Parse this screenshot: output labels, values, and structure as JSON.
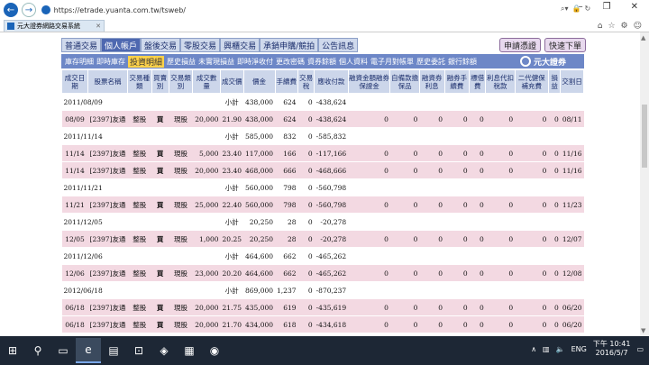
{
  "browser": {
    "url": "https://etrade.yuanta.com.tw/tsweb/",
    "tab_title": "元大證券網路交易系統",
    "window_controls": [
      "–",
      "❐",
      "✕"
    ]
  },
  "menu": {
    "items": [
      "普通交易",
      "個人帳戶",
      "盤後交易",
      "零股交易",
      "興櫃交易",
      "承銷申購/競拍",
      "公告訊息"
    ],
    "active_index": 1,
    "right_buttons": [
      "申請憑證",
      "快速下單"
    ]
  },
  "submenu": {
    "items": [
      "庫存明細",
      "即時庫存",
      "投資明細",
      "歷史損益",
      "未實現損益",
      "即時淨收付",
      "更改密碼",
      "資券餘額",
      "個人資料",
      "電子月對帳單",
      "歷史委託",
      "銀行餘額"
    ],
    "active_index": 2,
    "logo_text": "元大證券"
  },
  "table": {
    "headers": [
      "成交日期",
      "股票名稱",
      "交易種類",
      "買賣別",
      "交易類別",
      "成交數量",
      "成交價",
      "價金",
      "手續費",
      "交易稅",
      "應收付款",
      "融資金額融券保證金",
      "自備款擔保品",
      "融資券利息",
      "融券手續費",
      "標借費",
      "利息代扣稅款",
      "二代健保補充費",
      "損益",
      "交割日"
    ],
    "rows": [
      {
        "type": "sum",
        "date": "2011/08/09",
        "label": "小計",
        "amount": "438,000",
        "fee": "624",
        "tax": "0",
        "net": "-438,624"
      },
      {
        "type": "det",
        "date": "08/09",
        "stock": "[2397]友通",
        "kind": "整股",
        "side": "買",
        "cat": "現股",
        "qty": "20,000",
        "price": "21.90",
        "amount": "438,000",
        "fee": "624",
        "tax": "0",
        "net": "-438,624",
        "z1": "0",
        "z2": "0",
        "z3": "0",
        "z4": "0",
        "z5": "0",
        "z6": "0",
        "z7": "0",
        "z8": "0",
        "settle": "08/11"
      },
      {
        "type": "sum",
        "date": "2011/11/14",
        "label": "小計",
        "amount": "585,000",
        "fee": "832",
        "tax": "0",
        "net": "-585,832"
      },
      {
        "type": "det",
        "date": "11/14",
        "stock": "[2397]友通",
        "kind": "整股",
        "side": "買",
        "cat": "現股",
        "qty": "5,000",
        "price": "23.40",
        "amount": "117,000",
        "fee": "166",
        "tax": "0",
        "net": "-117,166",
        "z1": "0",
        "z2": "0",
        "z3": "0",
        "z4": "0",
        "z5": "0",
        "z6": "0",
        "z7": "0",
        "z8": "0",
        "settle": "11/16"
      },
      {
        "type": "det",
        "date": "11/14",
        "stock": "[2397]友通",
        "kind": "整股",
        "side": "買",
        "cat": "現股",
        "qty": "20,000",
        "price": "23.40",
        "amount": "468,000",
        "fee": "666",
        "tax": "0",
        "net": "-468,666",
        "z1": "0",
        "z2": "0",
        "z3": "0",
        "z4": "0",
        "z5": "0",
        "z6": "0",
        "z7": "0",
        "z8": "0",
        "settle": "11/16"
      },
      {
        "type": "sum",
        "date": "2011/11/21",
        "label": "小計",
        "amount": "560,000",
        "fee": "798",
        "tax": "0",
        "net": "-560,798"
      },
      {
        "type": "det",
        "date": "11/21",
        "stock": "[2397]友通",
        "kind": "整股",
        "side": "買",
        "cat": "現股",
        "qty": "25,000",
        "price": "22.40",
        "amount": "560,000",
        "fee": "798",
        "tax": "0",
        "net": "-560,798",
        "z1": "0",
        "z2": "0",
        "z3": "0",
        "z4": "0",
        "z5": "0",
        "z6": "0",
        "z7": "0",
        "z8": "0",
        "settle": "11/23"
      },
      {
        "type": "sum",
        "date": "2011/12/05",
        "label": "小計",
        "amount": "20,250",
        "fee": "28",
        "tax": "0",
        "net": "-20,278"
      },
      {
        "type": "det",
        "date": "12/05",
        "stock": "[2397]友通",
        "kind": "整股",
        "side": "買",
        "cat": "現股",
        "qty": "1,000",
        "price": "20.25",
        "amount": "20,250",
        "fee": "28",
        "tax": "0",
        "net": "-20,278",
        "z1": "0",
        "z2": "0",
        "z3": "0",
        "z4": "0",
        "z5": "0",
        "z6": "0",
        "z7": "0",
        "z8": "0",
        "settle": "12/07"
      },
      {
        "type": "sum",
        "date": "2011/12/06",
        "label": "小計",
        "amount": "464,600",
        "fee": "662",
        "tax": "0",
        "net": "-465,262"
      },
      {
        "type": "det",
        "date": "12/06",
        "stock": "[2397]友通",
        "kind": "整股",
        "side": "買",
        "cat": "現股",
        "qty": "23,000",
        "price": "20.20",
        "amount": "464,600",
        "fee": "662",
        "tax": "0",
        "net": "-465,262",
        "z1": "0",
        "z2": "0",
        "z3": "0",
        "z4": "0",
        "z5": "0",
        "z6": "0",
        "z7": "0",
        "z8": "0",
        "settle": "12/08"
      },
      {
        "type": "sum",
        "date": "2012/06/18",
        "label": "小計",
        "amount": "869,000",
        "fee": "1,237",
        "tax": "0",
        "net": "-870,237"
      },
      {
        "type": "det",
        "date": "06/18",
        "stock": "[2397]友通",
        "kind": "整股",
        "side": "買",
        "cat": "現股",
        "qty": "20,000",
        "price": "21.75",
        "amount": "435,000",
        "fee": "619",
        "tax": "0",
        "net": "-435,619",
        "z1": "0",
        "z2": "0",
        "z3": "0",
        "z4": "0",
        "z5": "0",
        "z6": "0",
        "z7": "0",
        "z8": "0",
        "settle": "06/20"
      },
      {
        "type": "det",
        "date": "06/18",
        "stock": "[2397]友通",
        "kind": "整股",
        "side": "買",
        "cat": "現股",
        "qty": "20,000",
        "price": "21.70",
        "amount": "434,000",
        "fee": "618",
        "tax": "0",
        "net": "-434,618",
        "z1": "0",
        "z2": "0",
        "z3": "0",
        "z4": "0",
        "z5": "0",
        "z6": "0",
        "z7": "0",
        "z8": "0",
        "settle": "06/20"
      }
    ]
  },
  "taskbar": {
    "lang": "ENG",
    "time": "下午 10:41",
    "date": "2016/5/7"
  }
}
